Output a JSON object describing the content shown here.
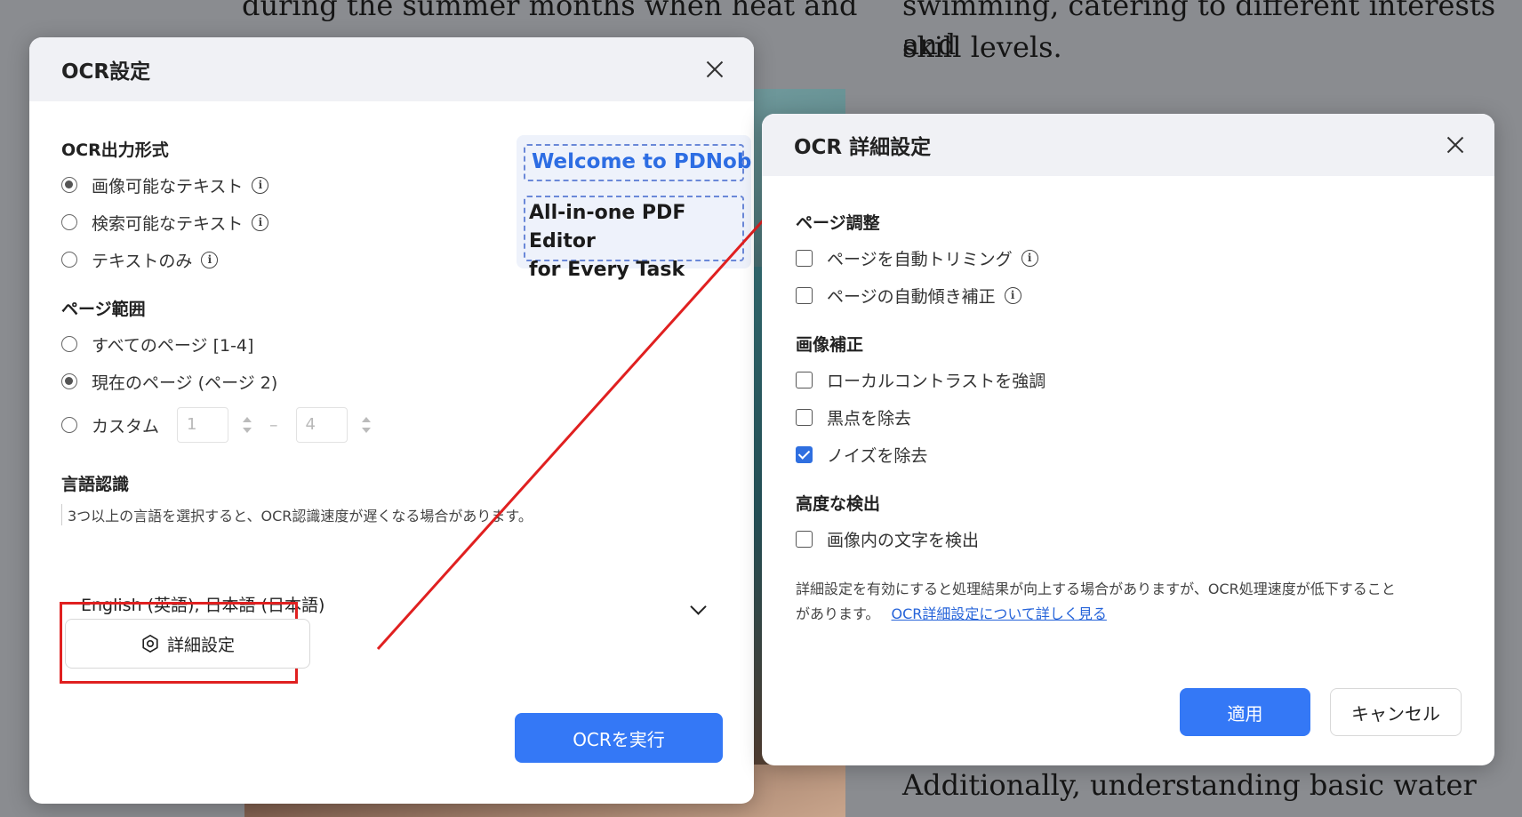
{
  "background_doc": {
    "left_line": "during the summer months when heat and",
    "right_line1": "swimming, catering to different interests and",
    "right_line2": "skill levels.",
    "bottom_line": "Additionally, understanding basic water"
  },
  "ocr_dialog": {
    "title": "OCR設定",
    "output_format": {
      "title": "OCR出力形式",
      "options": [
        {
          "label": "画像可能なテキスト",
          "selected": true
        },
        {
          "label": "検索可能なテキスト",
          "selected": false
        },
        {
          "label": "テキストのみ",
          "selected": false
        }
      ]
    },
    "page_range": {
      "title": "ページ範囲",
      "options": [
        {
          "label": "すべてのページ [1-4]",
          "selected": false
        },
        {
          "label": "現在のページ (ページ 2)",
          "selected": true
        },
        {
          "label": "カスタム",
          "selected": false
        }
      ],
      "custom_from_placeholder": "1",
      "custom_separator": "–",
      "custom_to_placeholder": "4"
    },
    "language": {
      "title": "言語認識",
      "note": "3つ以上の言語を選択すると、OCR認識速度が遅くなる場合があります。",
      "selected": "English (英語), 日本語 (日本語)"
    },
    "advanced_button": "詳細設定",
    "run_button": "OCRを実行",
    "promo": {
      "welcome": "Welcome to PDNob",
      "tagline_1": "All-in-one PDF Editor",
      "tagline_2": "for Every Task"
    }
  },
  "advanced_dialog": {
    "title": "OCR 詳細設定",
    "page_adjust": {
      "title": "ページ調整",
      "options": [
        {
          "label": "ページを自動トリミング",
          "checked": false
        },
        {
          "label": "ページの自動傾き補正",
          "checked": false
        }
      ]
    },
    "image_fix": {
      "title": "画像補正",
      "options": [
        {
          "label": "ローカルコントラストを強調",
          "checked": false
        },
        {
          "label": "黒点を除去",
          "checked": false
        },
        {
          "label": "ノイズを除去",
          "checked": true
        }
      ]
    },
    "advanced_detect": {
      "title": "高度な検出",
      "options": [
        {
          "label": "画像内の文字を検出",
          "checked": false
        }
      ]
    },
    "note_line1": "詳細設定を有効にすると処理結果が向上する場合がありますが、OCR処理速度が低下すること",
    "note_line2": "があります。",
    "learn_more_link": "OCR詳細設定について詳しく見る",
    "apply_button": "適用",
    "cancel_button": "キャンセル"
  },
  "colors": {
    "accent": "#3478f6",
    "highlight": "#e02020",
    "checked": "#2f6fe0"
  }
}
